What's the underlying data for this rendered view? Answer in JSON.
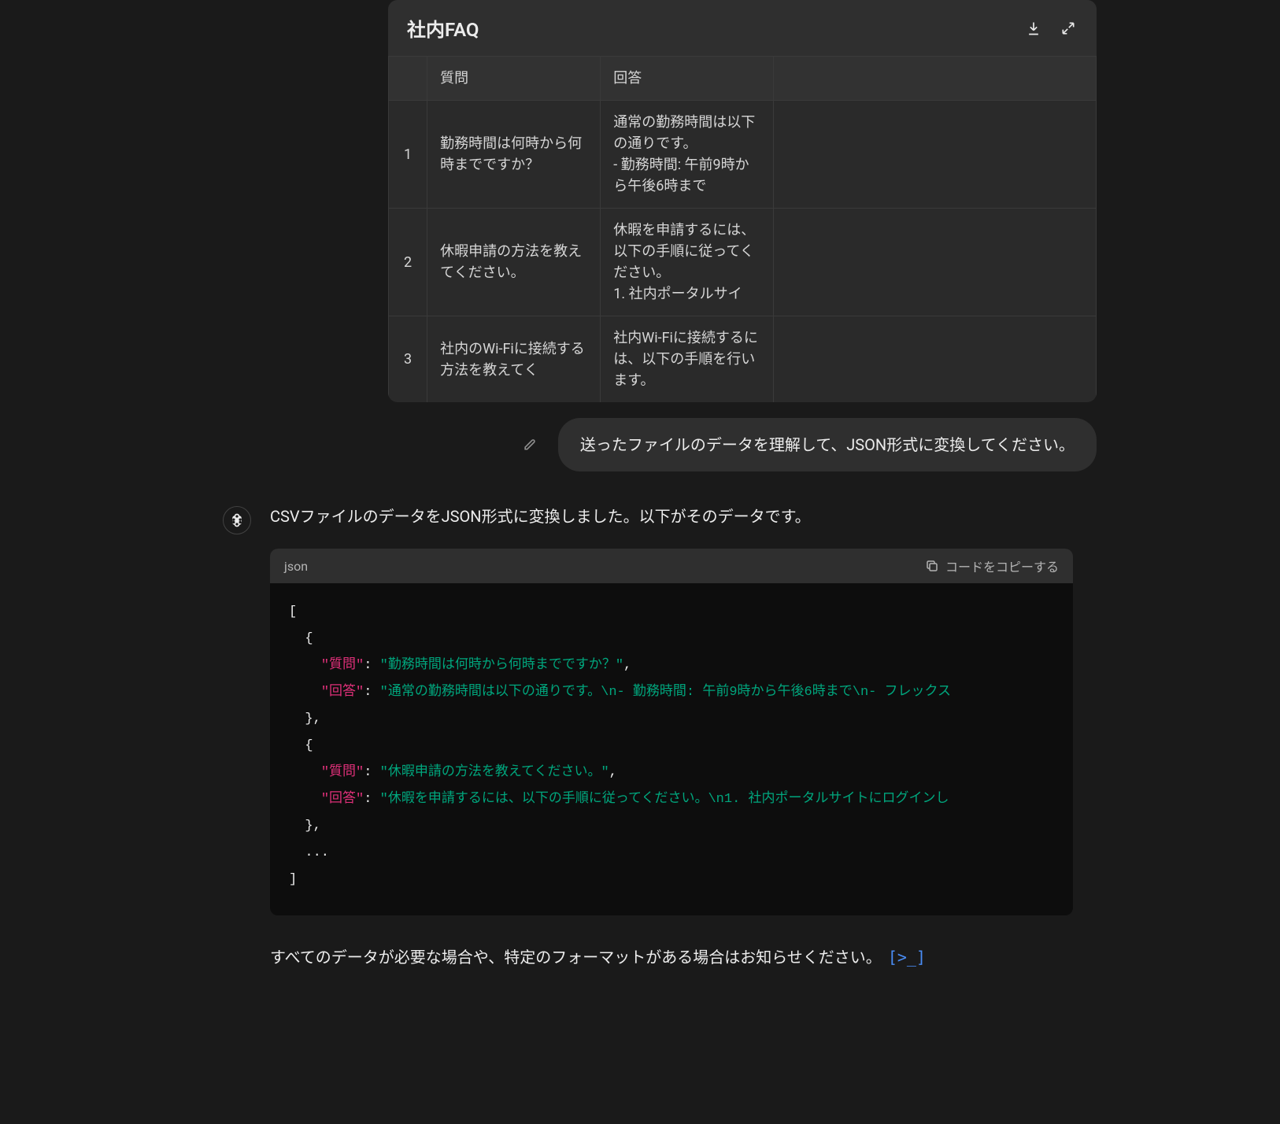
{
  "table": {
    "title": "社内FAQ",
    "headers": {
      "q": "質問",
      "a": "回答"
    },
    "rows": [
      {
        "idx": "1",
        "q": "勤務時間は何時から何時までですか？",
        "a": "通常の勤務時間は以下の通りです。\n- 勤務時間: 午前9時から午後6時まで"
      },
      {
        "idx": "2",
        "q": "休暇申請の方法を教えてください。",
        "a": "休暇を申請するには、以下の手順に従ってください。\n1. 社内ポータルサイ"
      },
      {
        "idx": "3",
        "q": "社内のWi-Fiに接続する方法を教えてく",
        "a": "社内Wi-Fiに接続するには、以下の手順を行います。"
      }
    ]
  },
  "user_message": "送ったファイルのデータを理解して、JSON形式に変換してください。",
  "assistant_intro": "CSVファイルのデータをJSON形式に変換しました。以下がそのデータです。",
  "code": {
    "lang": "json",
    "copy_label": "コードをコピーする",
    "keys": {
      "q": "\"質問\"",
      "a": "\"回答\""
    },
    "obj1": {
      "q": "\"勤務時間は何時から何時までですか？\"",
      "a": "\"通常の勤務時間は以下の通りです。\\n- 勤務時間: 午前9時から午後6時まで\\n- フレックス"
    },
    "obj2": {
      "q": "\"休暇申請の方法を教えてください。\"",
      "a": "\"休暇を申請するには、以下の手順に従ってください。\\n1. 社内ポータルサイトにログインし"
    },
    "ellipsis": "..."
  },
  "followup_text": "すべてのデータが必要な場合や、特定のフォーマットがある場合はお知らせください。",
  "analysis_glyph": "[>_]"
}
